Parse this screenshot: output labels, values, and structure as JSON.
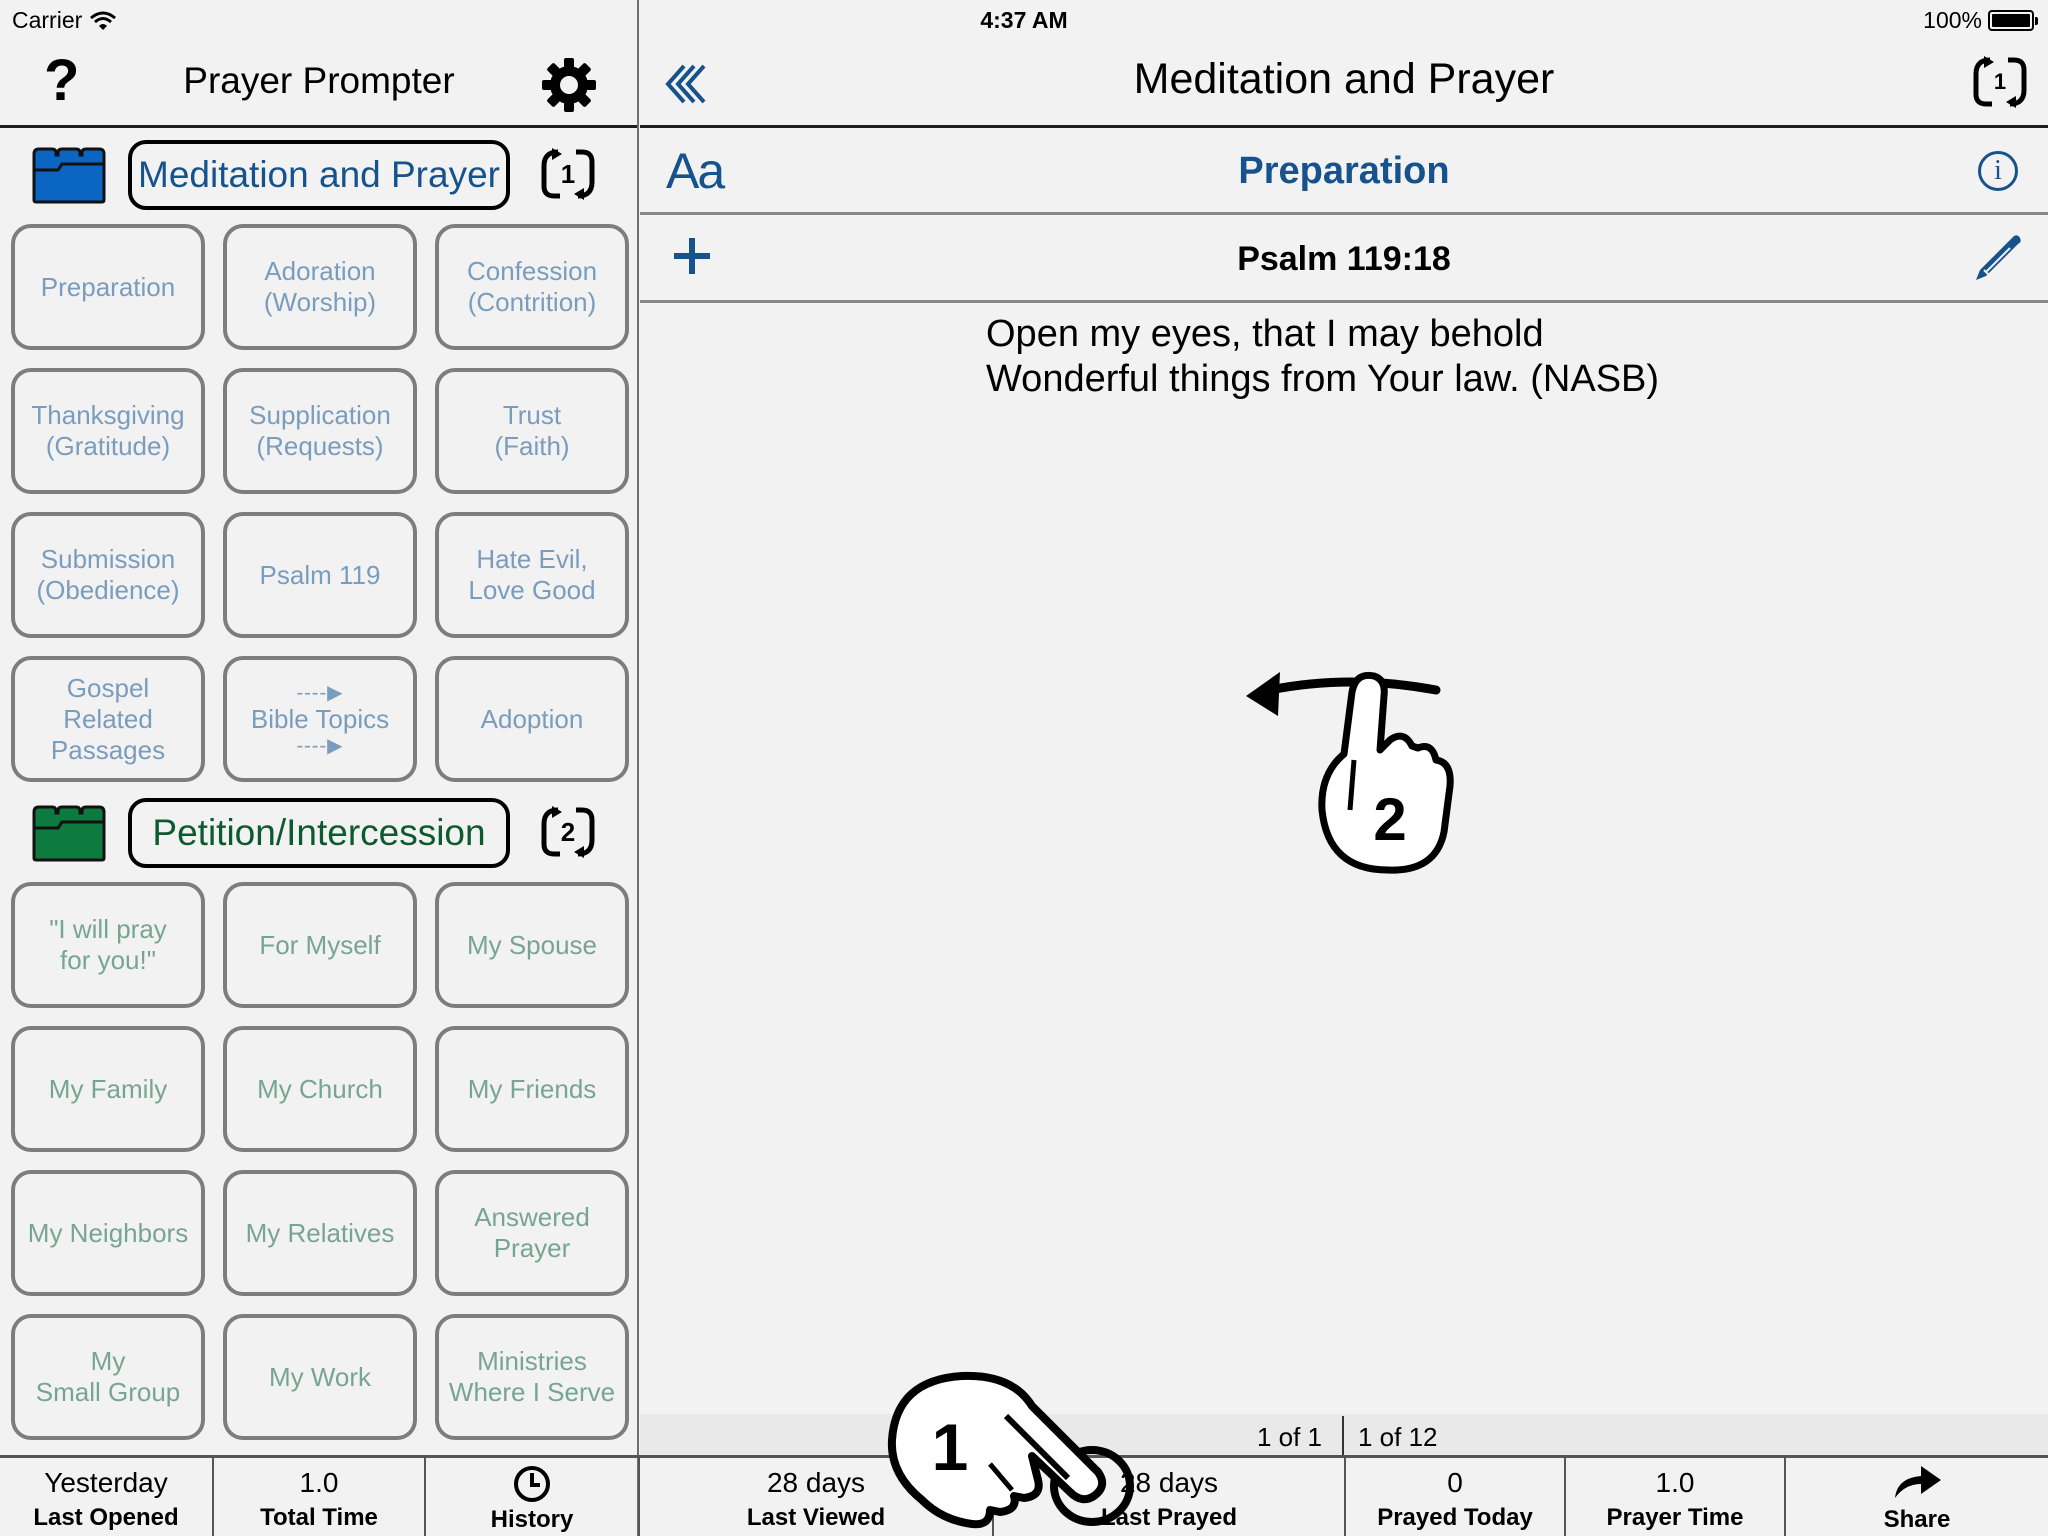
{
  "status_bar": {
    "carrier": "Carrier",
    "wifi_icon": "wifi-icon",
    "time": "4:37 AM",
    "battery": "100%",
    "battery_level": 1.0
  },
  "left_header": {
    "title": "Prayer Prompter",
    "help_label": "?",
    "help_icon": "question-mark-icon",
    "settings_icon": "gear-icon"
  },
  "right_header": {
    "title": "Meditation and Prayer",
    "back_icon": "triple-chevron-left-icon",
    "cycle_count": "1"
  },
  "colors": {
    "accent_blue": "#16528c",
    "folder_blue": "#0a66c2",
    "folder_green": "#0d7a3e",
    "section_green": "#0d5a2e",
    "tile_blue_text": "#7a9cbd",
    "tile_green_text": "#78a592"
  },
  "sections": [
    {
      "title": "Meditation and Prayer",
      "cycle_count": "1",
      "folder_icon": "folder-icon",
      "tiles": [
        {
          "label": "Preparation"
        },
        {
          "label": "Adoration\n(Worship)"
        },
        {
          "label": "Confession\n(Contrition)"
        },
        {
          "label": "Thanksgiving\n(Gratitude)"
        },
        {
          "label": "Supplication\n(Requests)"
        },
        {
          "label": "Trust\n(Faith)"
        },
        {
          "label": "Submission\n(Obedience)"
        },
        {
          "label": "Psalm 119"
        },
        {
          "label": "Hate Evil,\nLove Good"
        },
        {
          "label": "Gospel\nRelated\nPassages"
        },
        {
          "label": "Bible Topics",
          "arrow_top": "----▶",
          "arrow_bottom": "----▶"
        },
        {
          "label": "Adoption"
        }
      ]
    },
    {
      "title": "Petition/Intercession",
      "cycle_count": "2",
      "folder_icon": "folder-icon",
      "tiles": [
        {
          "label": "\"I will pray\nfor you!\""
        },
        {
          "label": "For Myself"
        },
        {
          "label": "My Spouse"
        },
        {
          "label": "My Family"
        },
        {
          "label": "My Church"
        },
        {
          "label": "My Friends"
        },
        {
          "label": "My Neighbors"
        },
        {
          "label": "My Relatives"
        },
        {
          "label": "Answered\nPrayer"
        },
        {
          "label": "My\nSmall Group"
        },
        {
          "label": "My Work"
        },
        {
          "label": "Ministries\nWhere I Serve"
        }
      ]
    }
  ],
  "content": {
    "font_button": "Aa",
    "topic_title": "Preparation",
    "info_label": "i",
    "verse_reference": "Psalm 119:18",
    "verse_text": "Open my eyes, that I may behold\nWonderful things from Your law. (NASB)",
    "add_icon": "plus-icon",
    "edit_icon": "pencil-icon"
  },
  "gestures": {
    "swipe_hint_number": "2",
    "tap_hint_number": "1"
  },
  "counters": {
    "item_position": "1 of 1",
    "topic_position": "1 of 12"
  },
  "stats": [
    {
      "value": "Yesterday",
      "label": "Last Opened"
    },
    {
      "value": "1.0",
      "label": "Total Time"
    },
    {
      "icon": "clock-icon",
      "label": "History"
    },
    {
      "value": "28 days",
      "label": "Last Viewed"
    },
    {
      "value": "28 days",
      "label": "Last Prayed"
    },
    {
      "value": "0",
      "label": "Prayed Today"
    },
    {
      "value": "1.0",
      "label": "Prayer Time"
    },
    {
      "icon": "share-arrow-icon",
      "label": "Share"
    }
  ]
}
